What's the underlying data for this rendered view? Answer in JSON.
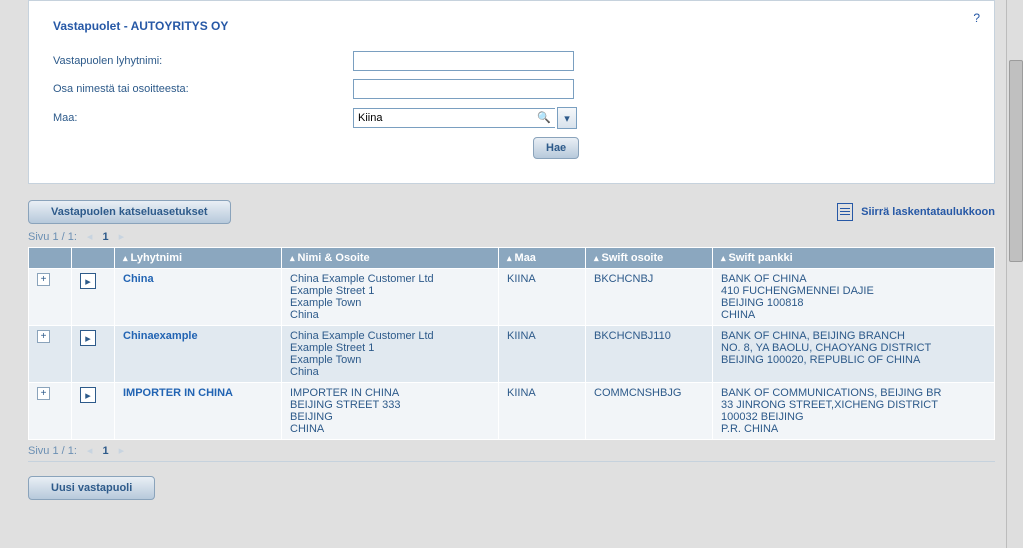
{
  "title": "Vastapuolet - AUTOYRITYS OY",
  "help_tooltip": "?",
  "form": {
    "short_name_label": "Vastapuolen lyhytnimi:",
    "short_name_value": "",
    "name_addr_label": "Osa nimestä tai osoitteesta:",
    "name_addr_value": "",
    "country_label": "Maa:",
    "country_value": "Kiina",
    "search_btn": "Hae"
  },
  "buttons": {
    "view_settings": "Vastapuolen katseluasetukset",
    "export": "Siirrä laskentataulukkoon",
    "new": "Uusi vastapuoli"
  },
  "pager": {
    "text": "Sivu 1 / 1:",
    "page": "1"
  },
  "columns": {
    "short": "Lyhytnimi",
    "name": "Nimi & Osoite",
    "country": "Maa",
    "swift_addr": "Swift osoite",
    "swift_bank": "Swift pankki"
  },
  "rows": [
    {
      "short": "China",
      "name": "China Example Customer Ltd\nExample Street 1\nExample Town\nChina",
      "country": "KIINA",
      "swift_addr": "BKCHCNBJ",
      "swift_bank": "BANK OF CHINA\n410 FUCHENGMENNEI DAJIE\nBEIJING 100818\nCHINA"
    },
    {
      "short": "Chinaexample",
      "name": "China Example Customer Ltd\nExample Street 1\nExample Town\nChina",
      "country": "KIINA",
      "swift_addr": "BKCHCNBJ110",
      "swift_bank": "BANK OF CHINA, BEIJING BRANCH\nNO. 8, YA BAOLU, CHAOYANG DISTRICT\nBEIJING 100020, REPUBLIC OF CHINA"
    },
    {
      "short": "IMPORTER IN CHINA",
      "name": "IMPORTER IN CHINA\nBEIJING STREET 333\nBEIJING\nCHINA",
      "country": "KIINA",
      "swift_addr": "COMMCNSHBJG",
      "swift_bank": "BANK OF COMMUNICATIONS, BEIJING BR\n33 JINRONG STREET,XICHENG DISTRICT\n100032 BEIJING\nP.R. CHINA"
    }
  ]
}
